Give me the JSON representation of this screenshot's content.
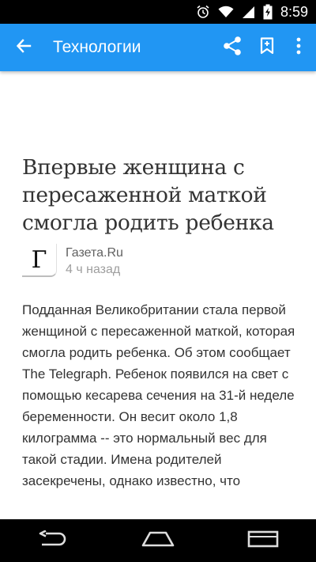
{
  "status_bar": {
    "time": "8:59",
    "icons": [
      "alarm-icon",
      "wifi-icon",
      "signal-icon",
      "battery-charging-icon"
    ]
  },
  "app_bar": {
    "title": "Технологии",
    "background": "#2196f3",
    "icons": [
      "back-arrow-icon",
      "share-icon",
      "bookmark-icon",
      "overflow-menu-icon"
    ]
  },
  "article": {
    "headline": "Впервые женщина с пересаженной маткой смогла родить ребенка",
    "source": {
      "logo_letter": "Г",
      "name": "Газета.Ru",
      "time": "4 ч назад"
    },
    "body": "Подданная Великобритании стала первой женщиной с пересаженной маткой, которая смогла родить ребенка. Об этом сообщает The Telegraph. Ребенок появился на свет с помощью кесарева сечения на 31-й неделе беременности. Он весит около 1,8 килограмма -- это нормальный вес для такой стадии. Имена родителей засекречены, однако известно, что"
  },
  "nav_bar": {
    "icons": [
      "back-nav-icon",
      "home-nav-icon",
      "recents-nav-icon"
    ]
  }
}
